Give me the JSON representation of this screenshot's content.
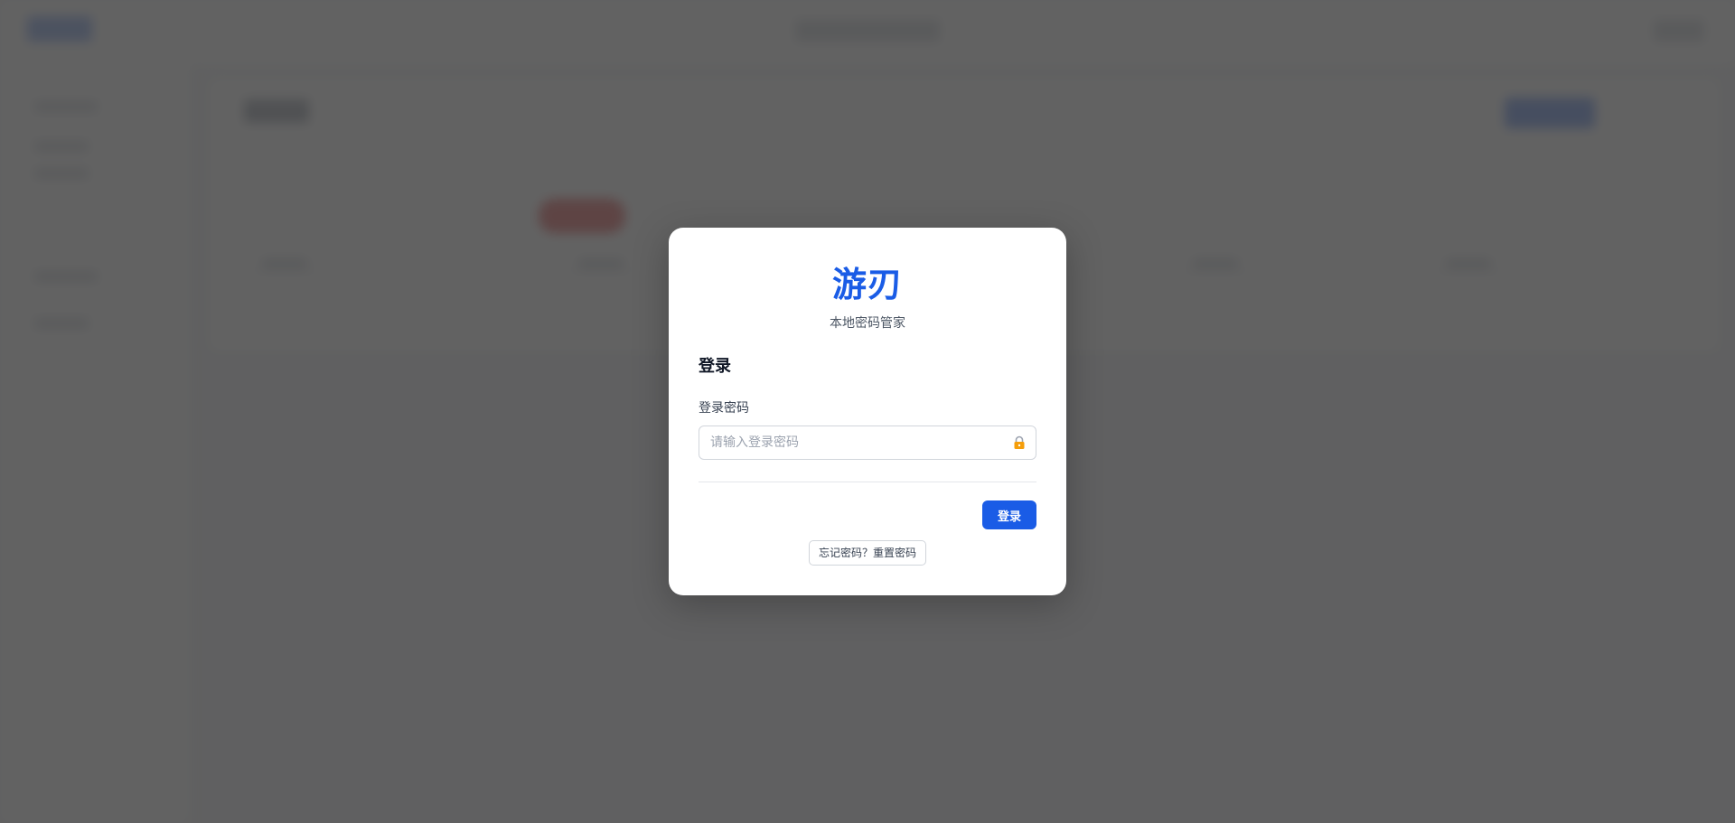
{
  "app": {
    "brand_title": "游刃",
    "brand_subtitle": "本地密码管家"
  },
  "login_form": {
    "heading": "登录",
    "password_label": "登录密码",
    "password_placeholder": "请输入登录密码",
    "password_value": "",
    "submit_label": "登录",
    "reset_link_label": "忘记密码？重置密码",
    "lock_icon": "lock-icon"
  },
  "colors": {
    "brand": "#1a5ce6",
    "overlay": "#404040",
    "lock_icon": "#f59e0b"
  }
}
